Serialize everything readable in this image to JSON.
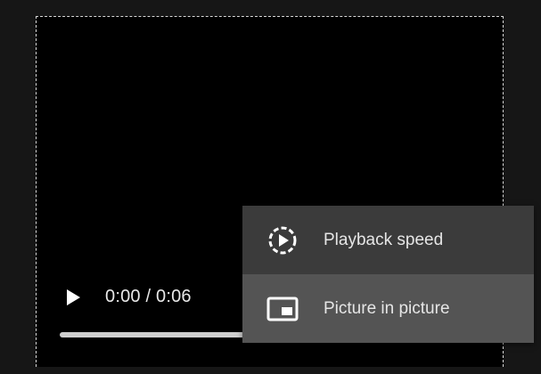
{
  "player": {
    "current_time": "0:00",
    "separator": " / ",
    "duration": "0:06",
    "progress_fraction": 0
  },
  "menu": {
    "items": [
      {
        "label": "Playback speed",
        "icon": "playback-speed-icon",
        "highlighted": false
      },
      {
        "label": "Picture in picture",
        "icon": "picture-in-picture-icon",
        "highlighted": true
      }
    ]
  },
  "colors": {
    "background": "#161616",
    "video": "#000000",
    "menu_bg": "#3b3b3b",
    "menu_highlight": "#545454",
    "text": "#e6e6e6"
  }
}
